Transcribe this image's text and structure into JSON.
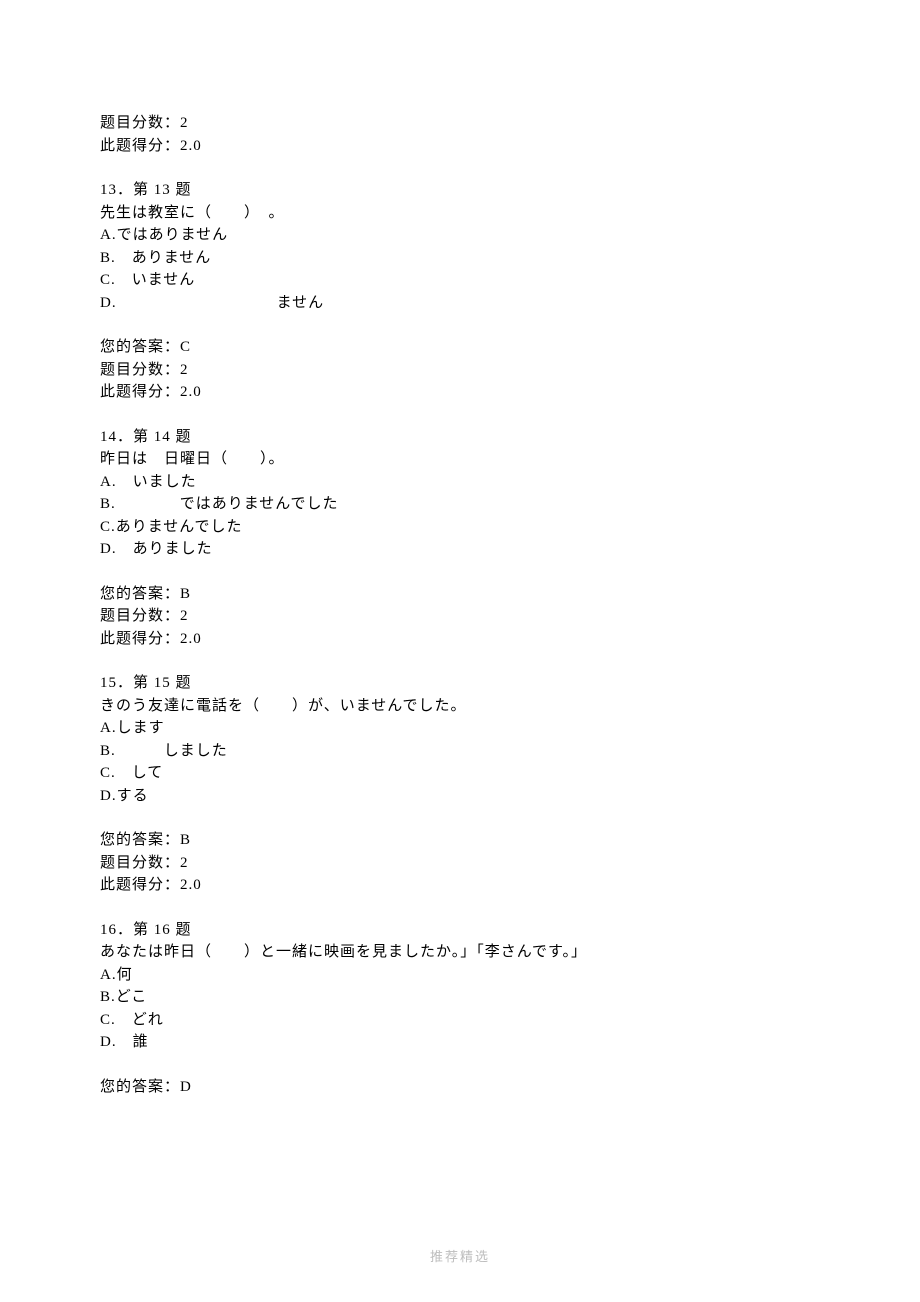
{
  "prev": {
    "maxscore_label": "题目分数：",
    "maxscore_value": "2",
    "score_label": "此题得分：",
    "score_value": "2.0"
  },
  "q13": {
    "header": "13．第 13 题",
    "prompt": "先生は教室に（　　）　。",
    "a": "A.ではありません",
    "b": "B.　ありません",
    "c": "C.　いません",
    "d": "D.　　　　　　　　　　ません",
    "answer_label": "您的答案：",
    "answer_value": "C",
    "maxscore_label": "题目分数：",
    "maxscore_value": "2",
    "score_label": "此题得分：",
    "score_value": "2.0"
  },
  "q14": {
    "header": "14．第 14 题",
    "prompt": "昨日は　日曜日（　　）。",
    "a": "A.　いました",
    "b": "B.　　　　ではありませんでした",
    "c": "C.ありませんでした",
    "d": "D.　ありました",
    "answer_label": "您的答案：",
    "answer_value": "B",
    "maxscore_label": "题目分数：",
    "maxscore_value": "2",
    "score_label": "此题得分：",
    "score_value": "2.0"
  },
  "q15": {
    "header": "15．第 15 题",
    "prompt": "きのう友達に電話を（　　）が、いませんでした。",
    "a": "A.します",
    "b": "B.　　　しました",
    "c": "C.　して",
    "d": "D.する",
    "answer_label": "您的答案：",
    "answer_value": "B",
    "maxscore_label": "题目分数：",
    "maxscore_value": "2",
    "score_label": "此题得分：",
    "score_value": "2.0"
  },
  "q16": {
    "header": "16．第 16 题",
    "prompt": "あなたは昨日（　　）と一緒に映画を見ましたか。」「李さんです。」",
    "a": "A.何",
    "b": "B.どこ",
    "c": "C.　どれ",
    "d": "D.　誰",
    "answer_label": "您的答案：",
    "answer_value": "D"
  },
  "footer": "推荐精选"
}
